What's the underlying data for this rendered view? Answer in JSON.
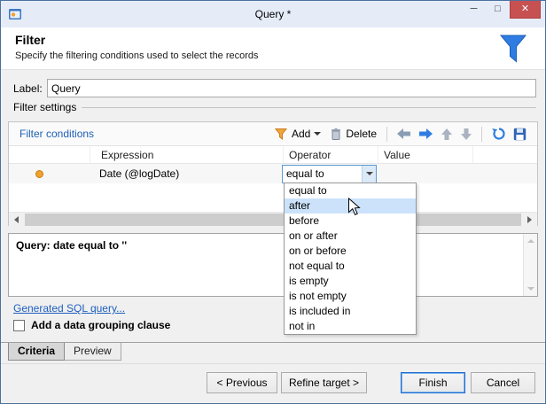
{
  "window": {
    "title": "Query *"
  },
  "window_controls": {
    "minimize": "─",
    "maximize": "□",
    "close": "✕"
  },
  "header": {
    "title": "Filter",
    "subtitle": "Specify the filtering conditions used to select the records"
  },
  "label_field": {
    "label": "Label:",
    "value": "Query"
  },
  "group_label": "Filter settings",
  "toolbar": {
    "caption": "Filter conditions",
    "add": "Add",
    "delete": "Delete"
  },
  "table": {
    "columns": [
      "Expression",
      "Operator",
      "Value"
    ],
    "row": {
      "expression": "Date (@logDate)",
      "operator": "equal to",
      "value": ""
    }
  },
  "operator_dropdown": {
    "items": [
      "equal to",
      "after",
      "before",
      "on or after",
      "on or before",
      "not equal to",
      "is empty",
      "is not empty",
      "is included in",
      "not in"
    ],
    "highlighted": "after",
    "highlighted_index": 1
  },
  "query_summary": "Query: date equal to ''",
  "sql_link": "Generated SQL query...",
  "grouping": {
    "label": "Add a data grouping clause",
    "checked": false
  },
  "tabs": {
    "criteria": "Criteria",
    "preview": "Preview"
  },
  "footer": {
    "previous": "< Previous",
    "refine": "Refine target >",
    "finish": "Finish",
    "cancel": "Cancel"
  },
  "colors": {
    "accent_blue": "#2f7de2",
    "close_red": "#c75050",
    "bullet_orange": "#f0a22e",
    "selection_blue": "#cbe2fa",
    "link_blue": "#1d5fbf",
    "titlebar": "#e5ecf8"
  }
}
